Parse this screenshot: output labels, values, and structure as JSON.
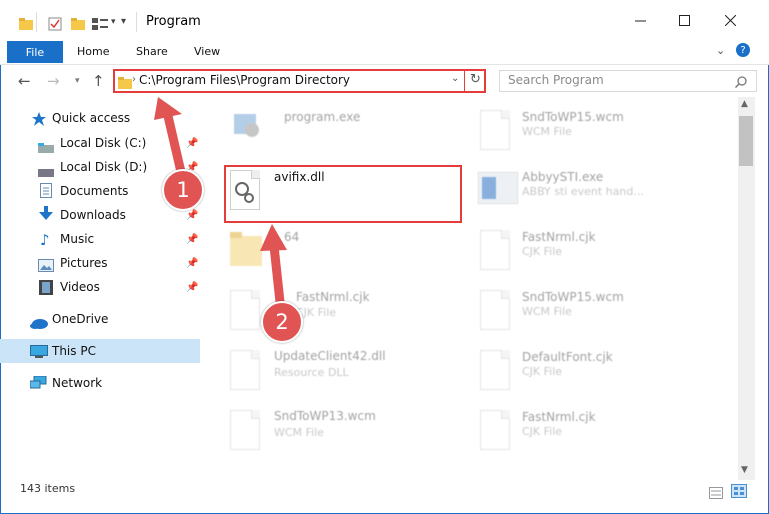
{
  "window": {
    "title": "Program",
    "accent": "#1a6fc9"
  },
  "ribbon": {
    "tabs": [
      "File",
      "Home",
      "Share",
      "View"
    ]
  },
  "navigation": {
    "address": "C:\\Program Files\\Program Directory",
    "search_placeholder": "Search Program"
  },
  "sidebar": {
    "items": [
      {
        "label": "Quick access",
        "icon": "star-icon"
      },
      {
        "label": "Local Disk (C:)",
        "icon": "drive-icon",
        "pinned": true
      },
      {
        "label": "Local Disk (D:)",
        "icon": "drive-icon",
        "pinned": true
      },
      {
        "label": "Documents",
        "icon": "documents-icon",
        "pinned": true
      },
      {
        "label": "Downloads",
        "icon": "download-icon",
        "pinned": true
      },
      {
        "label": "Music",
        "icon": "music-icon",
        "pinned": true
      },
      {
        "label": "Pictures",
        "icon": "pictures-icon",
        "pinned": true
      },
      {
        "label": "Videos",
        "icon": "videos-icon",
        "pinned": true
      },
      {
        "label": "OneDrive",
        "icon": "cloud-icon"
      },
      {
        "label": "This PC",
        "icon": "computer-icon",
        "selected": true
      },
      {
        "label": "Network",
        "icon": "network-icon"
      }
    ]
  },
  "files": {
    "left_column": [
      {
        "name": "program.exe",
        "type": ""
      },
      {
        "name": "avifix.dll",
        "type": ""
      },
      {
        "name": "64",
        "type": ""
      },
      {
        "name": "FastNrml.cjk",
        "type": "CJK File"
      },
      {
        "name": "UpdateClient42.dll",
        "type": "Resource DLL"
      },
      {
        "name": "SndToWP13.wcm",
        "type": "WCM File"
      }
    ],
    "right_column": [
      {
        "name": "SndToWP15.wcm",
        "type": "WCM File"
      },
      {
        "name": "AbbyySTI.exe",
        "type": "ABBY sti event hand..."
      },
      {
        "name": "FastNrml.cjk",
        "type": "CJK File"
      },
      {
        "name": "SndToWP15.wcm",
        "type": "WCM File"
      },
      {
        "name": "DefaultFont.cjk",
        "type": "CJK File"
      },
      {
        "name": "FastNrml.cjk",
        "type": "CJK File"
      }
    ]
  },
  "status": {
    "item_count": "143 items"
  },
  "annotations": {
    "step1": "1",
    "step2": "2",
    "color": "#e53c3c"
  }
}
